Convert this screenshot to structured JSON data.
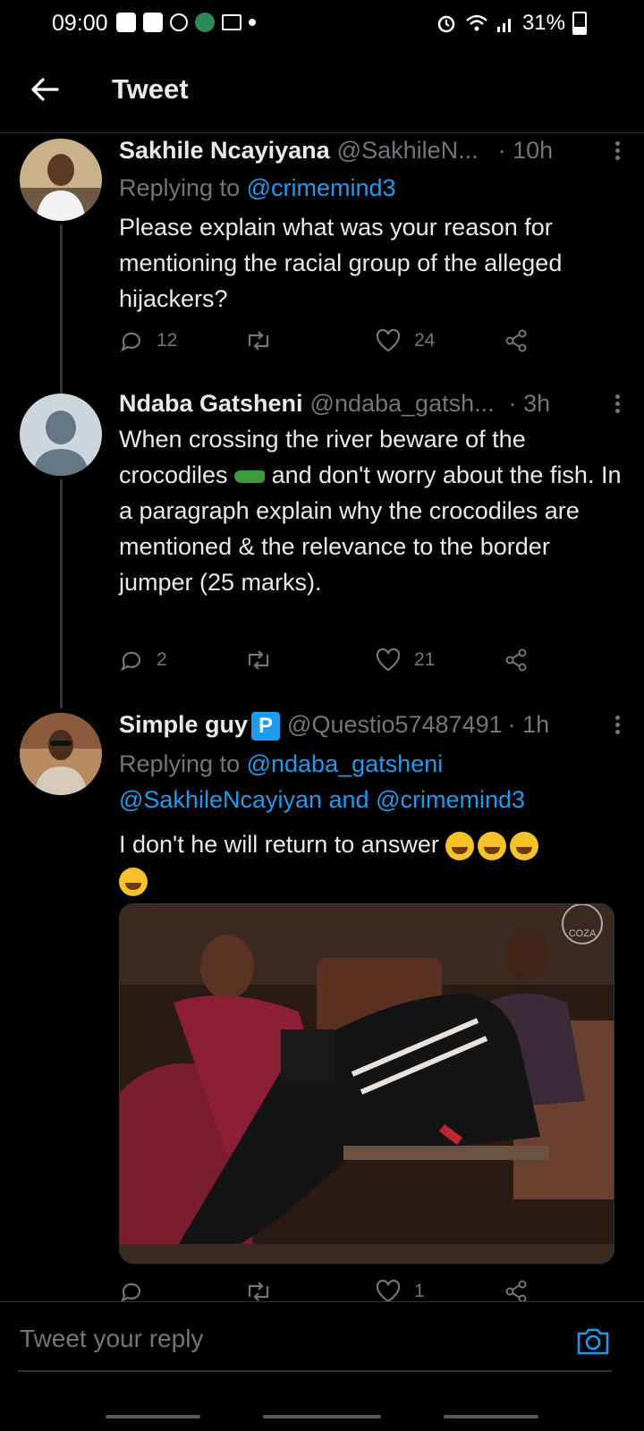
{
  "status": {
    "time": "09:00",
    "battery": "31%"
  },
  "header": {
    "title": "Tweet"
  },
  "tweets": [
    {
      "name": "Sakhile Ncayiyana",
      "handle": "@SakhileN...",
      "age": "· 10h",
      "replying_prefix": "Replying to ",
      "replying_to": "@crimemind3",
      "text": "Please explain what was your reason for mentioning the racial group of the alleged hijackers?",
      "replies": "12",
      "retweets": "",
      "likes": "24"
    },
    {
      "name": "Ndaba Gatsheni",
      "handle": "@ndaba_gatsh...",
      "age": "· 3h",
      "text_part1": "When crossing the river beware of the crocodiles",
      "text_part2": " and don't worry about the fish. In a paragraph explain why the crocodiles are mentioned & the relevance to the border jumper (25 marks).",
      "replies": "2",
      "retweets": "",
      "likes": "21"
    },
    {
      "name": "Simple guy",
      "badge": "P",
      "handle": "@Questio57487491",
      "age": "· 1h",
      "replying_prefix": "Replying to ",
      "replying_to_1": "@ndaba_gatsheni",
      "replying_to_2": "@SakhileNcayiyan",
      "replying_and": " and ",
      "replying_to_3": "@crimemind3",
      "text": "I don't he will return to answer ",
      "replies": "",
      "retweets": "",
      "likes": "1",
      "photo_watermark": "COZA"
    }
  ],
  "reply_bar": {
    "placeholder": "Tweet your reply"
  }
}
